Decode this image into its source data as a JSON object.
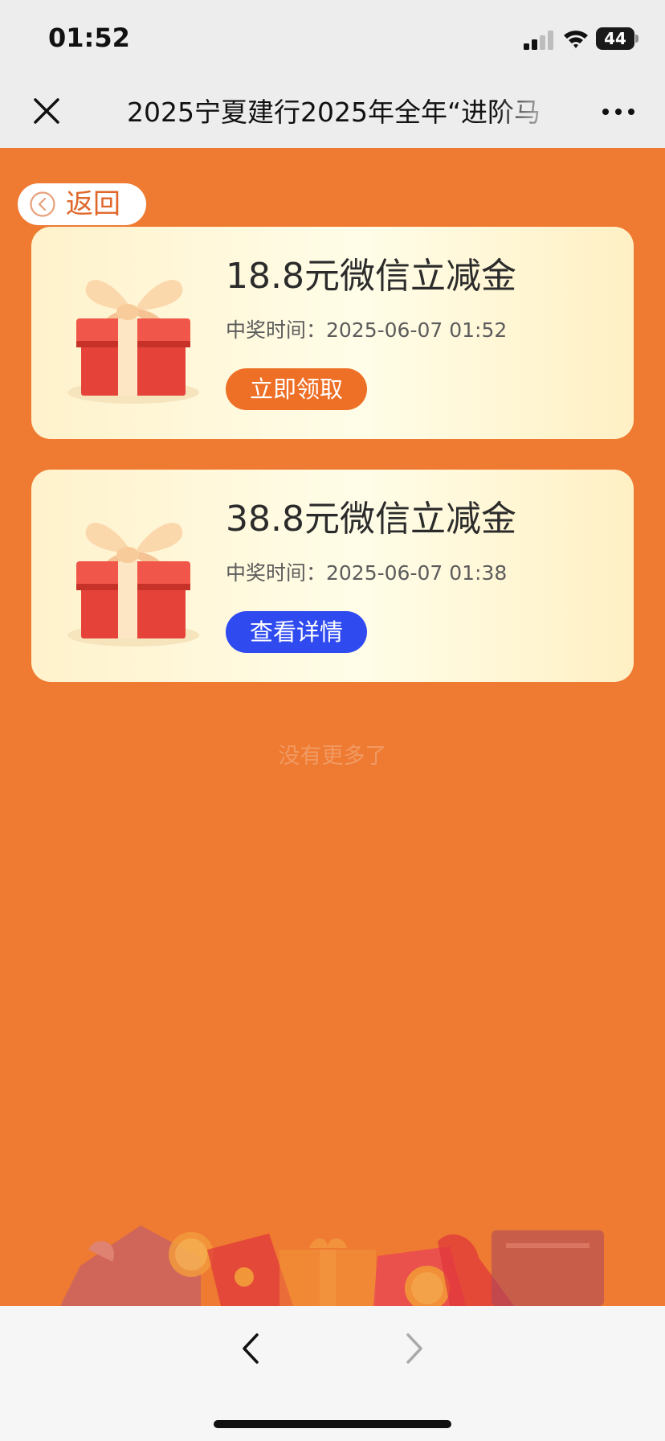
{
  "status_bar": {
    "time": "01:52",
    "battery": "44"
  },
  "nav": {
    "title": "2025宁夏建行2025年全年“进阶马"
  },
  "back_button": {
    "label": "返回"
  },
  "prizes": [
    {
      "title": "18.8元微信立减金",
      "time": "中奖时间：2025-06-07 01:52",
      "button": "立即领取"
    },
    {
      "title": "38.8元微信立减金",
      "time": "中奖时间：2025-06-07 01:38",
      "button": "查看详情"
    }
  ],
  "footer": {
    "no_more": "没有更多了"
  },
  "colors": {
    "page_bg": "#ef7a31",
    "claim_button": "#ee6f26",
    "detail_button": "#2f4bf0",
    "card_bg": "#fff7d6"
  },
  "icons": {
    "close": "close-icon",
    "more": "more-icon",
    "back": "chevron-left-circle-icon",
    "gift": "gift-box-icon",
    "nav_back": "chevron-left-icon",
    "nav_forward": "chevron-right-icon"
  }
}
